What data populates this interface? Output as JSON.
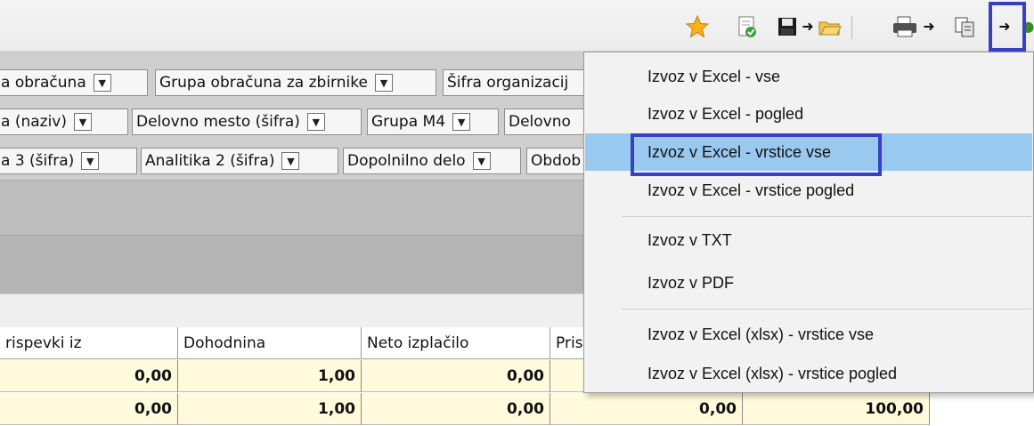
{
  "groups": {
    "row1": [
      "a obračuna",
      "Grupa obračuna za zbirnike",
      "Šifra organizacij"
    ],
    "row2": [
      "a (naziv)",
      "Delovno mesto (šifra)",
      "Grupa M4",
      "Delovno"
    ],
    "row3": [
      "a 3 (šifra)",
      "Analitika 2 (šifra)",
      "Dopolnilno delo",
      "Obdob"
    ]
  },
  "table": {
    "headers": [
      "rispevki iz",
      "Dohodnina",
      "Neto izplačilo",
      "Pris"
    ],
    "rows": [
      [
        "0,00",
        "1,00",
        "0,00"
      ],
      [
        "0,00",
        "1,00",
        "0,00",
        "0,00",
        "100,00"
      ]
    ]
  },
  "menu": {
    "items": [
      "Izvoz v Excel - vse",
      "Izvoz v Excel - pogled",
      "Izvoz v Excel - vrstice vse",
      "Izvoz v Excel - vrstice pogled",
      "Izvoz v TXT",
      "Izvoz v PDF",
      "Izvoz v Excel (xlsx) - vrstice vse",
      "Izvoz v Excel (xlsx) - vrstice pogled"
    ],
    "selected_index": 2
  },
  "toolbar": {
    "icons": [
      "star-icon",
      "document-check-icon",
      "save-icon",
      "arrow-icon",
      "open-folder-icon",
      "print-icon",
      "arrow-icon",
      "copy-icon",
      "export-arrow-icon",
      "more-icon"
    ]
  },
  "colors": {
    "highlight_border": "#3a3fc8",
    "menu_selection": "#99c9ef",
    "data_row_bg": "#fffadc"
  }
}
